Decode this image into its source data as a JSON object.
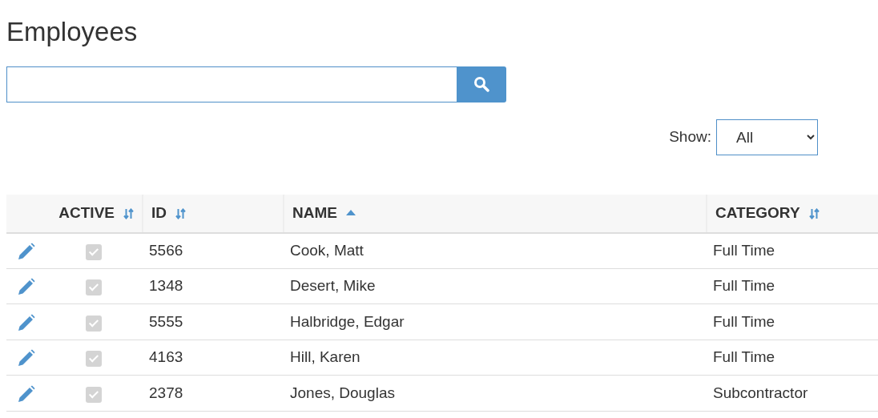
{
  "title": "Employees",
  "show_filter": {
    "label": "Show:",
    "value": "All"
  },
  "table": {
    "columns": [
      {
        "label": "ACTIVE",
        "sorted": false
      },
      {
        "label": "ID",
        "sorted": false
      },
      {
        "label": "NAME",
        "sorted": true
      },
      {
        "label": "CATEGORY",
        "sorted": false
      }
    ],
    "rows": [
      {
        "active": true,
        "id": "5566",
        "name": "Cook, Matt",
        "category": "Full Time"
      },
      {
        "active": true,
        "id": "1348",
        "name": "Desert, Mike",
        "category": "Full Time"
      },
      {
        "active": true,
        "id": "5555",
        "name": "Halbridge, Edgar",
        "category": "Full Time"
      },
      {
        "active": true,
        "id": "4163",
        "name": "Hill, Karen",
        "category": "Full Time"
      },
      {
        "active": true,
        "id": "2378",
        "name": "Jones, Douglas",
        "category": "Subcontractor"
      }
    ]
  }
}
